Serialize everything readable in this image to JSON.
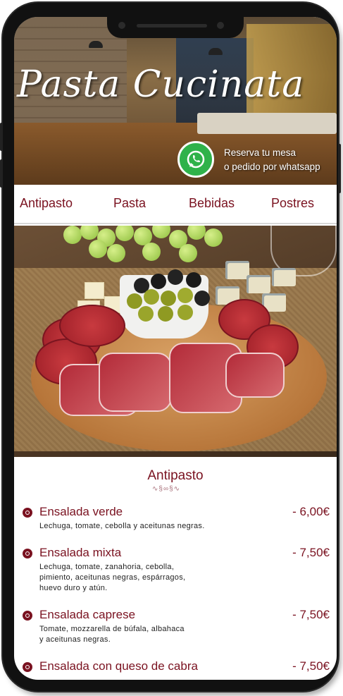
{
  "hero": {
    "title": "Pasta Cucinata",
    "reserve_line1": "Reserva tu mesa",
    "reserve_line2": "o pedido por whatsapp"
  },
  "tabs": [
    {
      "label": "Antipasto"
    },
    {
      "label": "Pasta"
    },
    {
      "label": "Bebidas"
    },
    {
      "label": "Postres"
    }
  ],
  "menu": {
    "section_title": "Antipasto",
    "flourish": "∿§∞§∿",
    "items": [
      {
        "name": "Ensalada verde",
        "price": "- 6,00€",
        "desc": "Lechuga, tomate, cebolla y aceitunas negras."
      },
      {
        "name": "Ensalada mixta",
        "price": "- 7,50€",
        "desc1": "Lechuga, tomate, zanahoria, cebolla,",
        "desc2": "pimiento, aceitunas negras, espárragos,",
        "desc3": "huevo duro y atún."
      },
      {
        "name": "Ensalada caprese",
        "price": "- 7,50€",
        "desc1": "Tomate, mozzarella de búfala, albahaca",
        "desc2": "y aceitunas negras."
      },
      {
        "name": "Ensalada con queso de cabra",
        "price": "- 7,50€"
      }
    ]
  },
  "colors": {
    "accent": "#7a1220",
    "whatsapp": "#2fb24a",
    "frame": "#111111"
  }
}
